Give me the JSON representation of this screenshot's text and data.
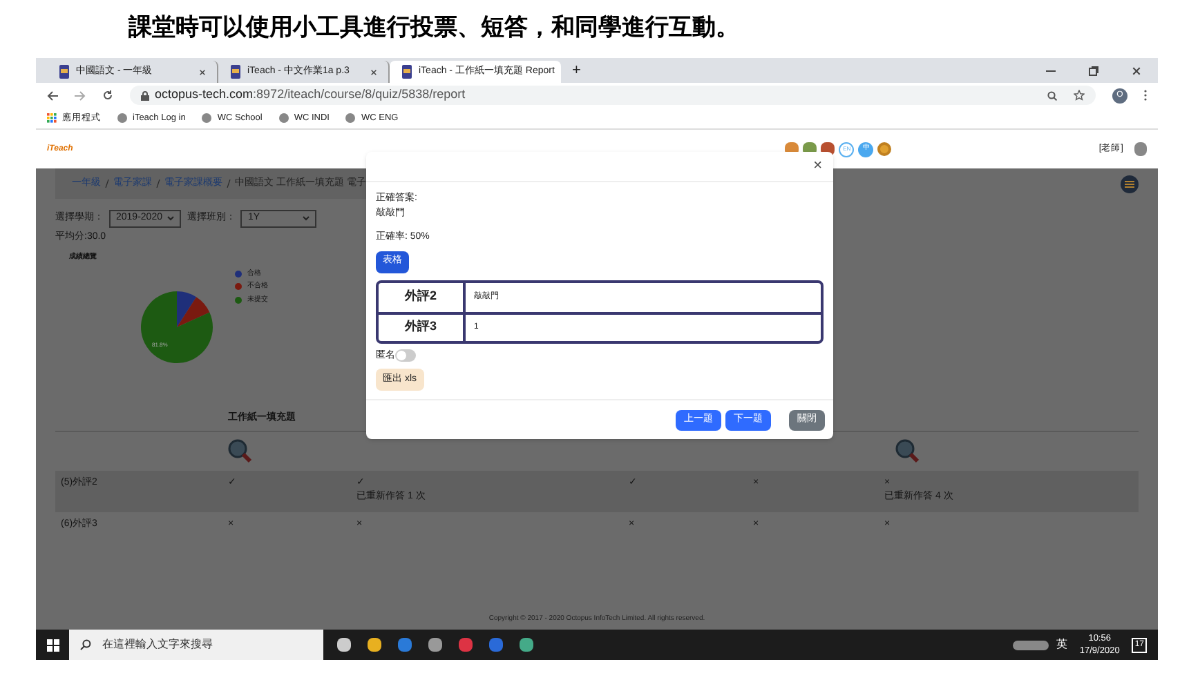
{
  "caption": "課堂時可以使用小工具進行投票、短答，和同學進行互動。",
  "browser": {
    "tabs": [
      {
        "label": "中國語文 - 一年級",
        "selected": false
      },
      {
        "label": "iTeach - 中文作業1a p.3",
        "selected": false
      },
      {
        "label": "iTeach - 工作紙一填充題 Report",
        "selected": true
      }
    ],
    "new_tab": "+",
    "url_host": "octopus-tech.com",
    "url_path": ":8972/iteach/course/8/quiz/5838/report",
    "profile": "O",
    "bookmarks": [
      "應用程式",
      "iTeach Log in",
      "WC School",
      "WC INDI",
      "WC ENG"
    ]
  },
  "site": {
    "logo": "iTeach",
    "lang_en": "EN",
    "lang_zh": "中",
    "role": "[老師]",
    "breadcrumb": [
      {
        "label": "一年級",
        "link": true
      },
      {
        "label": "電子家課",
        "link": true
      },
      {
        "label": "電子家課概要",
        "link": true
      },
      {
        "label": "中國語文 工作紙一填充題 電子",
        "link": false
      }
    ],
    "term_label": "選擇學期：",
    "term": "2019-2020",
    "class_label": "選擇班別：",
    "class": "1Y",
    "average": "平均分:30.0",
    "chart_data": {
      "type": "pie",
      "title": "成績總覽",
      "categories": [
        "合格",
        "不合格",
        "未提交"
      ],
      "values": [
        9.1,
        9.1,
        81.8
      ],
      "legend": "right",
      "colors": [
        "#1f2f7a",
        "#7a1a10",
        "#1d5a12"
      ],
      "value_labels": [
        null,
        null,
        "81.8%"
      ]
    },
    "table_heading": "工作紙一填充題",
    "rows": [
      {
        "label": "(5)外評2",
        "cells": [
          {
            "mark": "✓"
          },
          {
            "mark": "✓",
            "note": "已重新作答 1 次"
          },
          {
            "mark": "✓"
          },
          {
            "mark": "×"
          },
          {
            "mark": "×",
            "note": "已重新作答 4 次"
          }
        ]
      },
      {
        "label": "(6)外評3",
        "cells": [
          {
            "mark": "×"
          },
          {
            "mark": "×"
          },
          {
            "mark": "×"
          },
          {
            "mark": "×"
          },
          {
            "mark": "×"
          }
        ]
      }
    ],
    "copyright": "Copyright © 2017 - 2020 Octopus InfoTech Limited. All rights reserved."
  },
  "dialog": {
    "close": "×",
    "answer_label": "正確答案:",
    "answer": "敲敲門",
    "rate": "正確率: 50%",
    "table_button": "表格",
    "responses": [
      {
        "name": "外評2",
        "answer": "敲敲門"
      },
      {
        "name": "外評3",
        "answer": "1"
      }
    ],
    "anonymous": {
      "label": "匿名",
      "on": false
    },
    "export": "匯出 xls",
    "prev": "上一題",
    "next": "下一題",
    "close_button": "關閉"
  },
  "taskbar": {
    "search": "在這裡輸入文字來搜尋",
    "ime": "英",
    "time": "10:56",
    "date": "17/9/2020",
    "notifications": "17"
  }
}
